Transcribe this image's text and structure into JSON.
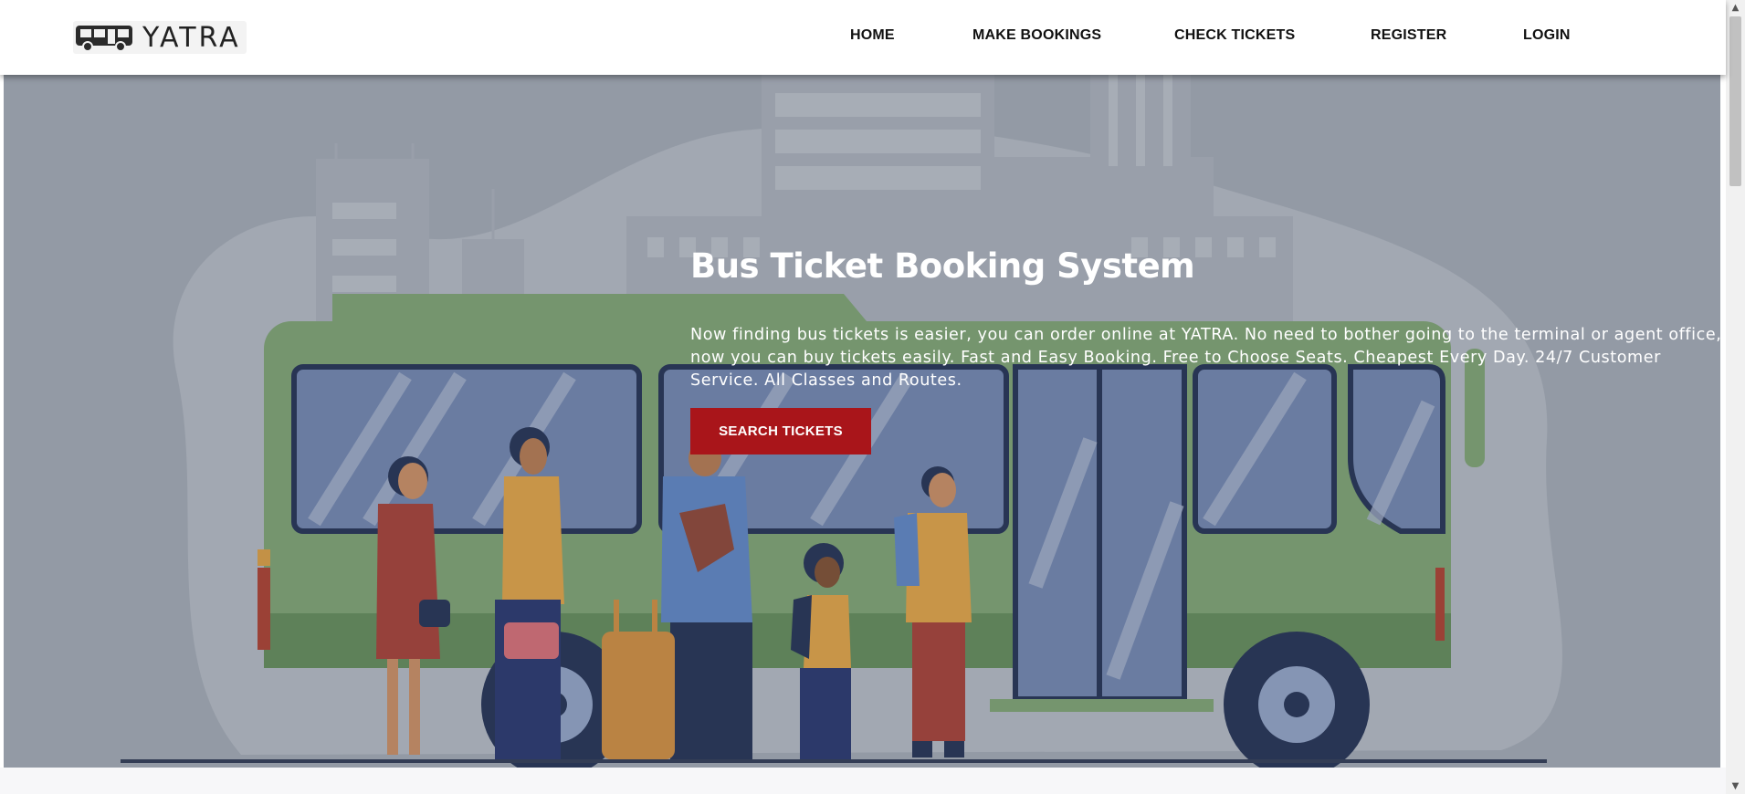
{
  "brand": {
    "name": "YATRA",
    "icon": "bus-icon"
  },
  "nav": [
    {
      "label": "HOME"
    },
    {
      "label": "MAKE BOOKINGS"
    },
    {
      "label": "CHECK TICKETS"
    },
    {
      "label": "REGISTER"
    },
    {
      "label": "LOGIN"
    }
  ],
  "hero": {
    "title": "Bus Ticket Booking System",
    "description": "Now finding bus tickets is easier, you can order online at YATRA. No need to bother going to the terminal or agent office, now you can buy tickets easily. Fast and Easy Booking. Free to Choose Seats. Cheapest Every Day. 24/7 Customer Service. All Classes and Routes.",
    "button_label": "SEARCH TICKETS",
    "illustration": "bus-stop-illustration"
  },
  "colors": {
    "accent": "#a9151a",
    "bus_green": "#7aa06e",
    "window_blue": "#6d82ad",
    "navy": "#1d2b4f"
  }
}
